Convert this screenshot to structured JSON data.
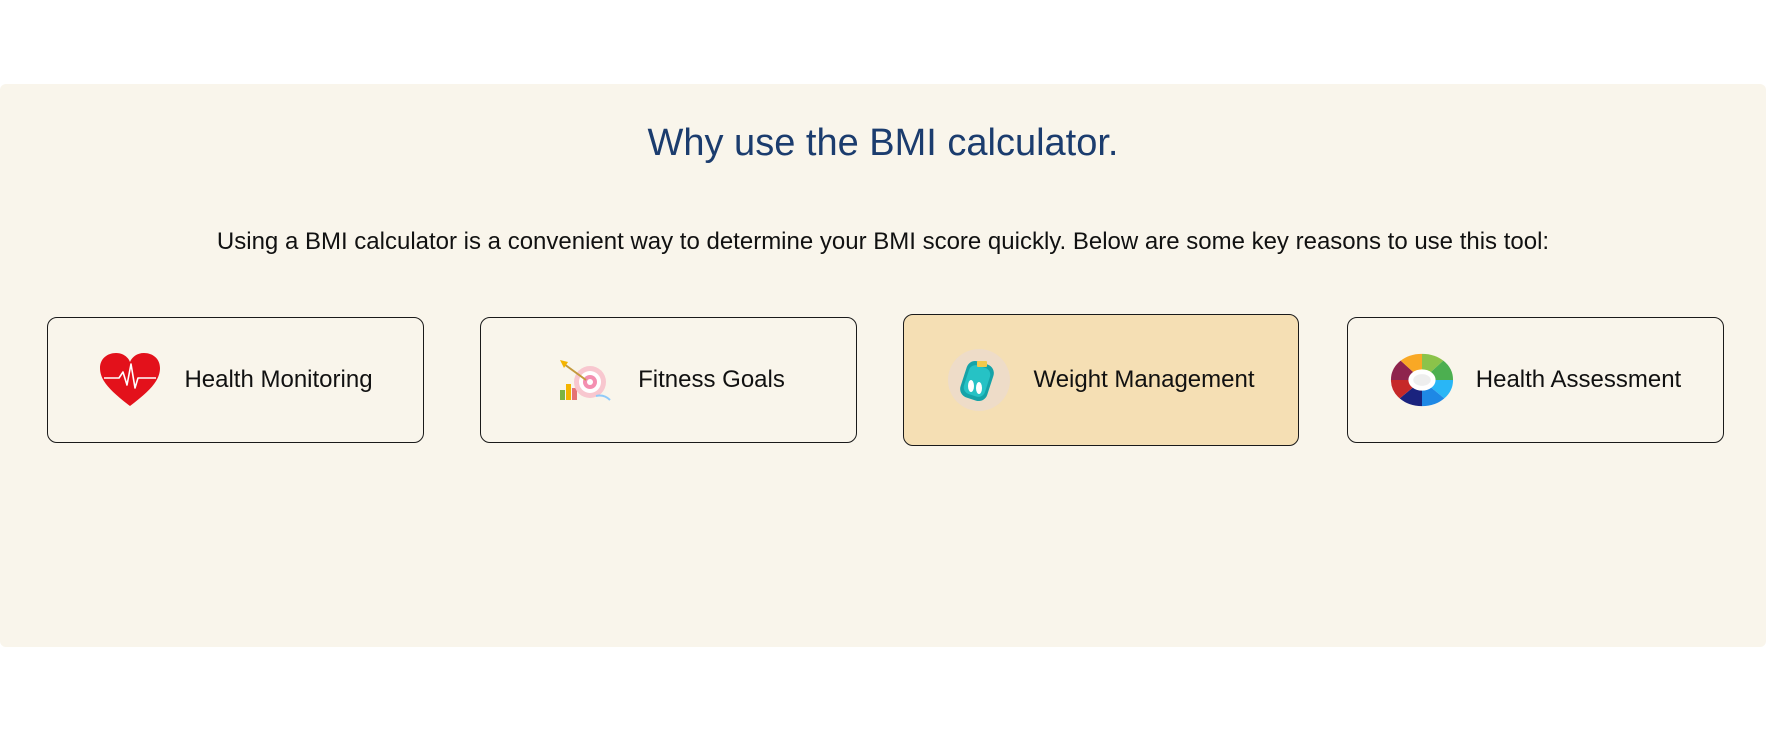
{
  "section": {
    "heading": "Why use the BMI calculator.",
    "intro": "Using a BMI calculator is a convenient way to determine your BMI score quickly. Below are some key reasons to use this tool:"
  },
  "reasons": [
    {
      "label": "Health Monitoring",
      "icon": "heart-icon",
      "active": false
    },
    {
      "label": "Fitness Goals",
      "icon": "target-icon",
      "active": false
    },
    {
      "label": "Weight Management",
      "icon": "scale-icon",
      "active": true
    },
    {
      "label": "Health Assessment",
      "icon": "wheel-icon",
      "active": false
    }
  ],
  "colors": {
    "section_bg": "#f9f5eb",
    "heading": "#1b3c6e",
    "active_card_bg": "#f5dfb4",
    "heart": "#e3111b"
  }
}
